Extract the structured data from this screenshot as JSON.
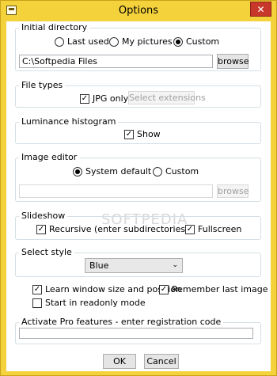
{
  "window": {
    "title": "Options",
    "close_glyph": "✕",
    "app_icon": "window-icon"
  },
  "initial_directory": {
    "legend": "Initial directory",
    "options": [
      "Last used",
      "My pictures",
      "Custom"
    ],
    "selected": "Custom",
    "path_value": "C:\\Softpedia Files",
    "browse_label": "browse"
  },
  "file_types": {
    "legend": "File types",
    "jpg_only_label": "JPG only",
    "jpg_only_checked": true,
    "select_ext_label": "Select extensions"
  },
  "luminance": {
    "legend": "Luminance histogram",
    "show_label": "Show",
    "show_checked": true
  },
  "image_editor": {
    "legend": "Image editor",
    "options": [
      "System default",
      "Custom"
    ],
    "selected": "System default",
    "path_value": "",
    "browse_label": "browse"
  },
  "slideshow": {
    "legend": "Slideshow",
    "recursive_label": "Recursive (enter subdirectories)",
    "recursive_checked": true,
    "fullscreen_label": "Fullscreen",
    "fullscreen_checked": true
  },
  "select_style": {
    "legend": "Select style",
    "value": "Blue",
    "chevron": "⌄"
  },
  "general": {
    "learn_window_label": "Learn window size and position",
    "learn_window_checked": true,
    "remember_image_label": "Remember last image",
    "remember_image_checked": true,
    "readonly_label": "Start in readonly mode",
    "readonly_checked": false
  },
  "pro": {
    "legend": "Activate Pro features - enter registration code",
    "code_value": ""
  },
  "footer": {
    "ok_label": "OK",
    "cancel_label": "Cancel"
  },
  "watermark": "SOFTPEDIA",
  "check_glyph": "✓",
  "colors": {
    "title_bar": "#f3d23c",
    "close_button": "#c7372a",
    "group_border": "#d5dfe5"
  }
}
